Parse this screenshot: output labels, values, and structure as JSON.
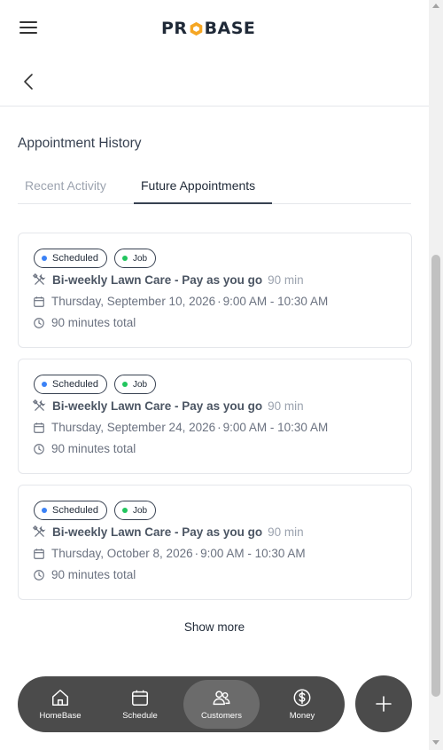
{
  "header": {
    "logo_text_left": "PR",
    "logo_text_right": "BASE",
    "menu_icon": "hamburger-icon",
    "back_icon": "chevron-left-icon"
  },
  "section": {
    "title": "Appointment History",
    "tabs": [
      {
        "label": "Recent Activity",
        "active": false
      },
      {
        "label": "Future Appointments",
        "active": true
      }
    ]
  },
  "appointments": [
    {
      "status": "Scheduled",
      "type": "Job",
      "service": "Bi-weekly Lawn Care - Pay as you go",
      "duration": "90 min",
      "date": "Thursday, September 10, 2026",
      "time": "9:00 AM - 10:30 AM",
      "total": "90 minutes total"
    },
    {
      "status": "Scheduled",
      "type": "Job",
      "service": "Bi-weekly Lawn Care - Pay as you go",
      "duration": "90 min",
      "date": "Thursday, September 24, 2026",
      "time": "9:00 AM - 10:30 AM",
      "total": "90 minutes total"
    },
    {
      "status": "Scheduled",
      "type": "Job",
      "service": "Bi-weekly Lawn Care - Pay as you go",
      "duration": "90 min",
      "date": "Thursday, October 8, 2026",
      "time": "9:00 AM - 10:30 AM",
      "total": "90 minutes total"
    }
  ],
  "show_more": "Show more",
  "nav": {
    "items": [
      {
        "label": "HomeBase",
        "icon": "home-icon",
        "active": false
      },
      {
        "label": "Schedule",
        "icon": "calendar-icon",
        "active": false
      },
      {
        "label": "Customers",
        "icon": "users-icon",
        "active": true
      },
      {
        "label": "Money",
        "icon": "dollar-icon",
        "active": false
      }
    ],
    "fab_icon": "plus-icon"
  },
  "colors": {
    "accent": "#f5a623",
    "scheduled_dot": "#3b82f6",
    "job_dot": "#22c55e",
    "nav_bg": "#4b4b4b"
  }
}
